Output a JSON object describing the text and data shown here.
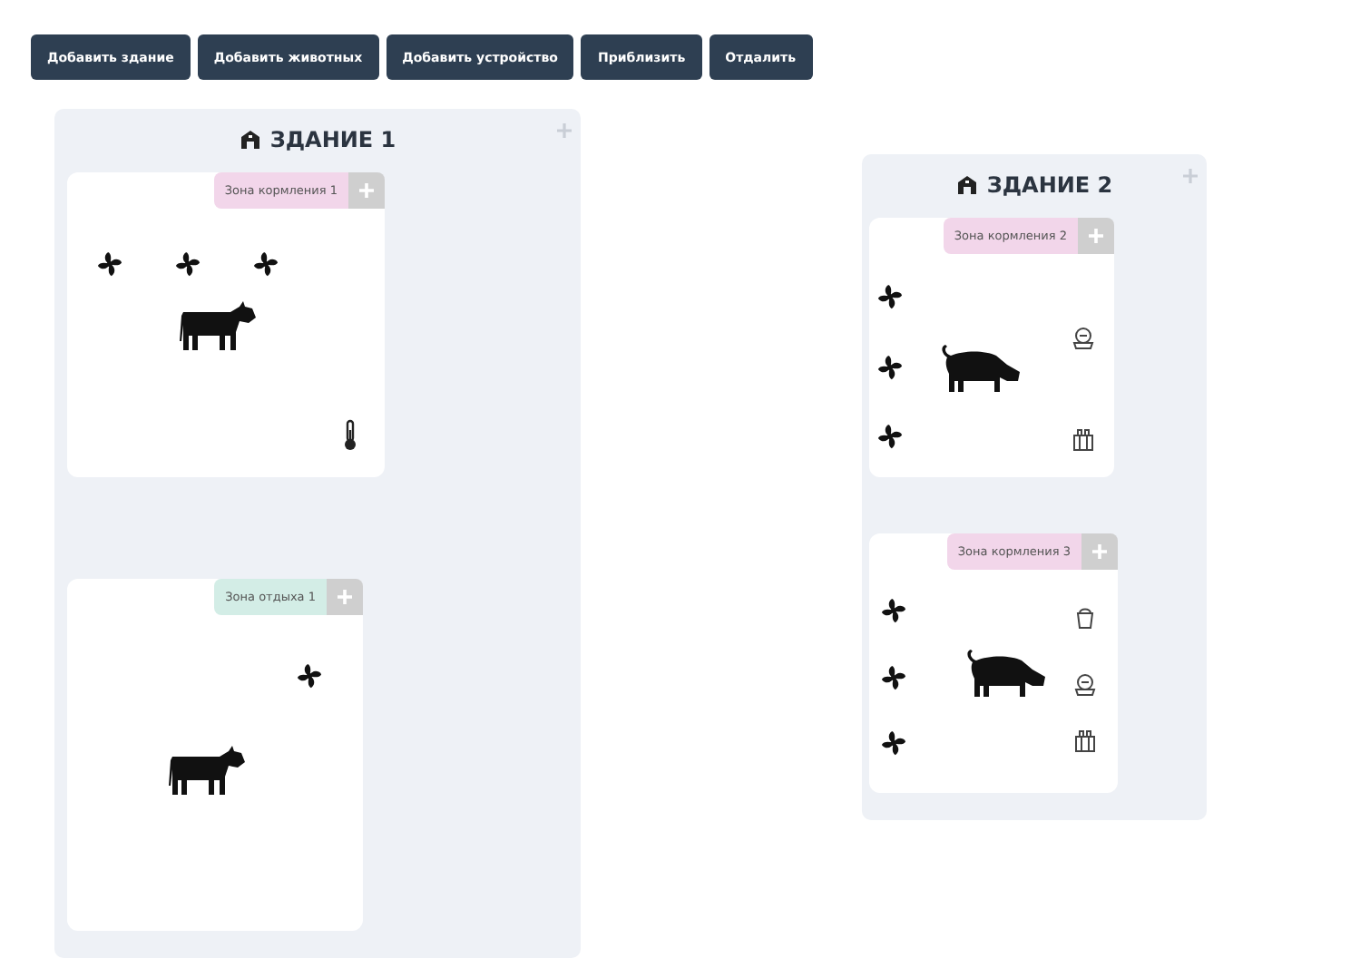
{
  "toolbar": [
    "Добавить здание",
    "Добавить животных",
    "Добавить устройство",
    "Приблизить",
    "Отдалить"
  ],
  "buildings": [
    {
      "title": "ЗДАНИЕ 1",
      "zones": [
        {
          "kind": "feeding",
          "label": "Зона кормления 1",
          "animals": [
            {
              "kind": "cow"
            }
          ],
          "devices": [
            {
              "kind": "fan"
            },
            {
              "kind": "fan"
            },
            {
              "kind": "fan"
            },
            {
              "kind": "thermometer"
            }
          ]
        },
        {
          "kind": "rest",
          "label": "Зона отдыха 1",
          "animals": [
            {
              "kind": "cow"
            }
          ],
          "devices": [
            {
              "kind": "fan"
            }
          ]
        }
      ]
    },
    {
      "title": "ЗДАНИЕ 2",
      "zones": [
        {
          "kind": "feeding",
          "label": "Зона кормления 2",
          "animals": [
            {
              "kind": "pig"
            }
          ],
          "devices": [
            {
              "kind": "fan"
            },
            {
              "kind": "fan"
            },
            {
              "kind": "fan"
            },
            {
              "kind": "feeder"
            },
            {
              "kind": "crate"
            }
          ]
        },
        {
          "kind": "feeding",
          "label": "Зона кормления 3",
          "animals": [
            {
              "kind": "pig"
            }
          ],
          "devices": [
            {
              "kind": "fan"
            },
            {
              "kind": "fan"
            },
            {
              "kind": "fan"
            },
            {
              "kind": "drinker"
            },
            {
              "kind": "feeder"
            },
            {
              "kind": "crate"
            }
          ]
        }
      ]
    }
  ]
}
